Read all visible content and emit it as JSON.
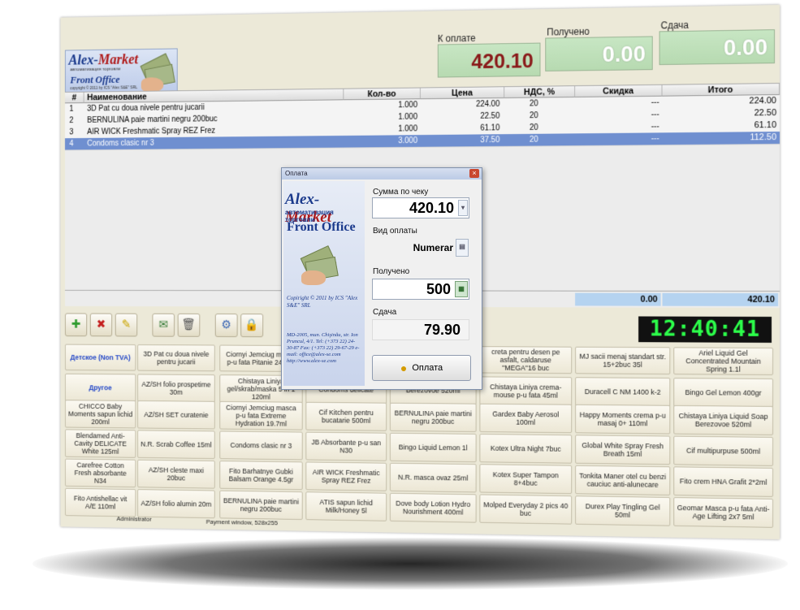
{
  "logo": {
    "title_a": "Alex-",
    "title_b": "Market",
    "sub": "автоматизация торговли",
    "front": "Front Office",
    "copy": "copyright © 2011 by ICS \"Alex S&E\" SRL"
  },
  "totals": {
    "due_label": "К оплате",
    "due_value": "420.10",
    "received_label": "Получено",
    "received_value": "0.00",
    "change_label": "Сдача",
    "change_value": "0.00"
  },
  "table": {
    "headers": {
      "num": "#",
      "name": "Наименование",
      "qty": "Кол-во",
      "price": "Цена",
      "vat": "НДС, %",
      "discount": "Скидка",
      "total": "Итого"
    },
    "rows": [
      {
        "num": "1",
        "name": "3D Pat cu doua nivele pentru jucarii",
        "qty": "1.000",
        "price": "224.00",
        "vat": "20",
        "discount": "---",
        "total": "224.00"
      },
      {
        "num": "2",
        "name": "BERNULINA paie martini negru 200buc",
        "qty": "1.000",
        "price": "22.50",
        "vat": "20",
        "discount": "---",
        "total": "22.50"
      },
      {
        "num": "3",
        "name": "AIR WICK Freshmatic Spray REZ Frez",
        "qty": "1.000",
        "price": "61.10",
        "vat": "20",
        "discount": "---",
        "total": "61.10"
      },
      {
        "num": "4",
        "name": "Condoms clasic nr 3",
        "qty": "3.000",
        "price": "37.50",
        "vat": "20",
        "discount": "---",
        "total": "112.50"
      }
    ],
    "sum_discount": "0.00",
    "sum_total": "420.10"
  },
  "clock": "12:40:41",
  "products": [
    [
      "Детское (Non TVA)",
      "3D Pat cu doua nivele pentru jucarii",
      "Ciornyi Jemciug masca p-u fata Pitanie 24.2ml",
      "",
      "",
      "creta pentru desen pe asfalt, caldaruse \"MEGA\"16 buc",
      "MJ sacii menaj standart str. 15+2buc 35l",
      "Ariel Liquid Gel Concentrated Mountain Spring 1.1l"
    ],
    [
      "Другое",
      "AZ/SH folio prospetime 30m",
      "Chistaya Liniya gel/skrab/maska 5 in 1 120ml",
      "Condoms delicate",
      "Berezovoe 520ml",
      "Chistaya Liniya crema-mouse p-u fata 45ml",
      "Duracell C NM 1400 k-2",
      "Bingo Gel Lemon 400gr"
    ],
    [
      "CHICCO Baby Moments sapun lichid 200ml",
      "AZ/SH SET curatenie",
      "Ciornyi Jemciug masca p-u fata Extreme Hydration 19.7ml",
      "Cif Kitchen pentru bucatarie 500ml",
      "BERNULINA paie martini negru 200buc",
      "Gardex Baby Aerosol 100ml",
      "Happy Moments crema p-u masaj 0+ 110ml",
      "Chistaya Liniya Liquid Soap Berezovoe 520ml"
    ],
    [
      "Blendamed Anti-Cavity DELICATE White 125ml",
      "N.R. Scrab Coffee 15ml",
      "Condoms clasic nr 3",
      "JB Absorbante p-u san N30",
      "Bingo Liquid Lemon 1l",
      "Kotex Ultra Night 7buc",
      "Global White Spray Fresh Breath 15ml",
      "Cif multipurpuse 500ml"
    ],
    [
      "Carefree Cotton Fresh absorbante N34",
      "AZ/SH cleste maxi 20buc",
      "Fito Barhatnye Gubki Balsam Orange 4.5gr",
      "AIR WICK Freshmatic Spray REZ Frez",
      "N.R. masca ovaz 25ml",
      "Kotex Super Tampon 8+4buc",
      "Tonkita Maner otel cu benzi cauciuc anti-alunecare",
      "Fito crem HNA Grafit 2*2ml"
    ],
    [
      "Fito Antishellac vit A/E 110ml",
      "AZ/SH folio alumin 20m",
      "BERNULINA paie martini negru 200buc",
      "ATIS sapun lichid Milk/Honey 5l",
      "Dove body Lotion Hydro Nourishment 400ml",
      "Molped Everyday 2 pics 40 buc",
      "Durex Play Tingling Gel 50ml",
      "Geomar Masca p-u fata Anti-Age Lifting 2x7 5ml"
    ]
  ],
  "status": {
    "user": "Administrator",
    "info": "Payment window, 528x255"
  },
  "dialog": {
    "title": "Оплата",
    "close": "×",
    "logo_a": "Alex-",
    "logo_b": "Market",
    "logo_sub": "автоматизация торговли",
    "logo_front": "Front Office",
    "logo_copy": "Copiright © 2011 by ICS \"Alex S&E\" SRL",
    "logo_addr": "MD-2005, mun. Chişinău, str. Ion Pruncul, 4/1. Tel: (+373 22) 24-30-87 Fax: (+373 22) 29-67-29 e-mail: office@alex-se.com http://www.alex-se.com",
    "sum_label": "Сумма по чеку",
    "sum_value": "420.10",
    "type_label": "Вид оплаты",
    "type_value": "Numerar",
    "received_label": "Получено",
    "received_value": "500",
    "change_label": "Сдача",
    "change_value": "79.90",
    "pay_button": "Оплата"
  }
}
